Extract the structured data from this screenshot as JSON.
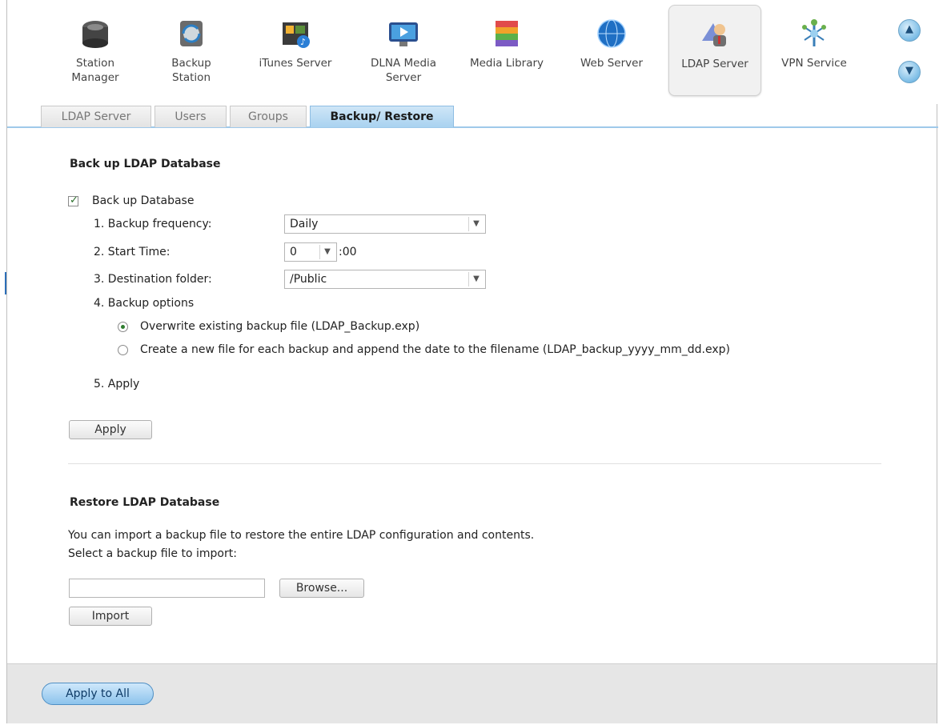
{
  "apps": [
    {
      "name": "station-manager",
      "label": "Station Manager",
      "icon": "hard-drive-icon"
    },
    {
      "name": "backup-station",
      "label": "Backup Station",
      "icon": "backup-icon"
    },
    {
      "name": "itunes-server",
      "label": "iTunes Server",
      "icon": "music-icon"
    },
    {
      "name": "dlna-media-server",
      "label": "DLNA Media Server",
      "icon": "monitor-icon"
    },
    {
      "name": "media-library",
      "label": "Media Library",
      "icon": "library-icon"
    },
    {
      "name": "web-server",
      "label": "Web Server",
      "icon": "globe-icon"
    },
    {
      "name": "ldap-server",
      "label": "LDAP Server",
      "icon": "user-directory-icon",
      "selected": true
    },
    {
      "name": "vpn-service",
      "label": "VPN Service",
      "icon": "network-icon"
    }
  ],
  "tabs": [
    "LDAP Server",
    "Users",
    "Groups",
    "Backup/ Restore"
  ],
  "active_tab": "Backup/ Restore",
  "backup": {
    "title": "Back up LDAP Database",
    "checkbox_label": "Back up Database",
    "checked": true,
    "freq_label": "1. Backup frequency:",
    "freq_value": "Daily",
    "time_label": "2. Start Time:",
    "time_value": "0",
    "time_suffix": ":00",
    "dest_label": "3. Destination folder:",
    "dest_value": "/Public",
    "options_label": "4. Backup options",
    "option1": "Overwrite existing backup file (LDAP_Backup.exp)",
    "option2": "Create a new file for each backup and append the date to the filename (LDAP_backup_yyyy_mm_dd.exp)",
    "selected_option": 1,
    "apply_step": "5. Apply",
    "apply_button": "Apply"
  },
  "restore": {
    "title": "Restore LDAP Database",
    "desc": "You can import a backup file to restore the entire LDAP configuration and contents.",
    "select_label": "Select a backup file to import:",
    "file_value": "",
    "browse_button": "Browse...",
    "import_button": "Import"
  },
  "footer": {
    "apply_all": "Apply to All"
  },
  "colors": {
    "accent": "#a9d2f0",
    "tab_border": "#9fc9ea",
    "footer_bg": "#e6e6e6"
  }
}
